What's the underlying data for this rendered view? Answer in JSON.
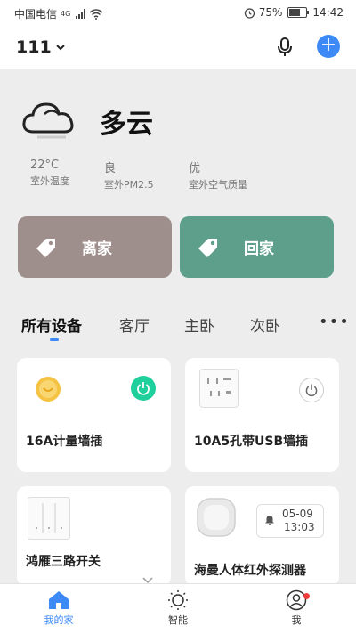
{
  "status_bar": {
    "carrier": "中国电信",
    "network": "4G",
    "battery_text": "75%",
    "battery_level": 0.75,
    "time": "14:42"
  },
  "header": {
    "home_name": "111",
    "icons": [
      "mic-icon",
      "add-icon"
    ],
    "add_symbol": "+"
  },
  "weather": {
    "description": "多云",
    "icon": "cloud-icon",
    "metrics": [
      {
        "value": "22°C",
        "label": "室外温度"
      },
      {
        "value": "良",
        "label": "室外PM2.5"
      },
      {
        "value": "优",
        "label": "室外空气质量"
      }
    ]
  },
  "scenes": [
    {
      "label": "离家",
      "color": "#9e8e8c"
    },
    {
      "label": "回家",
      "color": "#5e9f8b"
    }
  ],
  "tabs": {
    "items": [
      "所有设备",
      "客厅",
      "主卧",
      "次卧"
    ],
    "active": "所有设备",
    "more": "•••"
  },
  "devices": [
    {
      "name": "16A计量墙插",
      "power": "on"
    },
    {
      "name": "10A5孔带USB墙插",
      "power": "off"
    },
    {
      "name": "鸿雁三路开关"
    },
    {
      "name": "海曼人体红外探测器",
      "time_date": "05-09",
      "time_clock": "13:03"
    }
  ],
  "bottom_nav": {
    "items": [
      "我的家",
      "智能",
      "我"
    ],
    "active": "我的家"
  },
  "colors": {
    "accent": "#3d8af7",
    "power_on": "#1fcf9c",
    "notify": "#f23b3b"
  }
}
